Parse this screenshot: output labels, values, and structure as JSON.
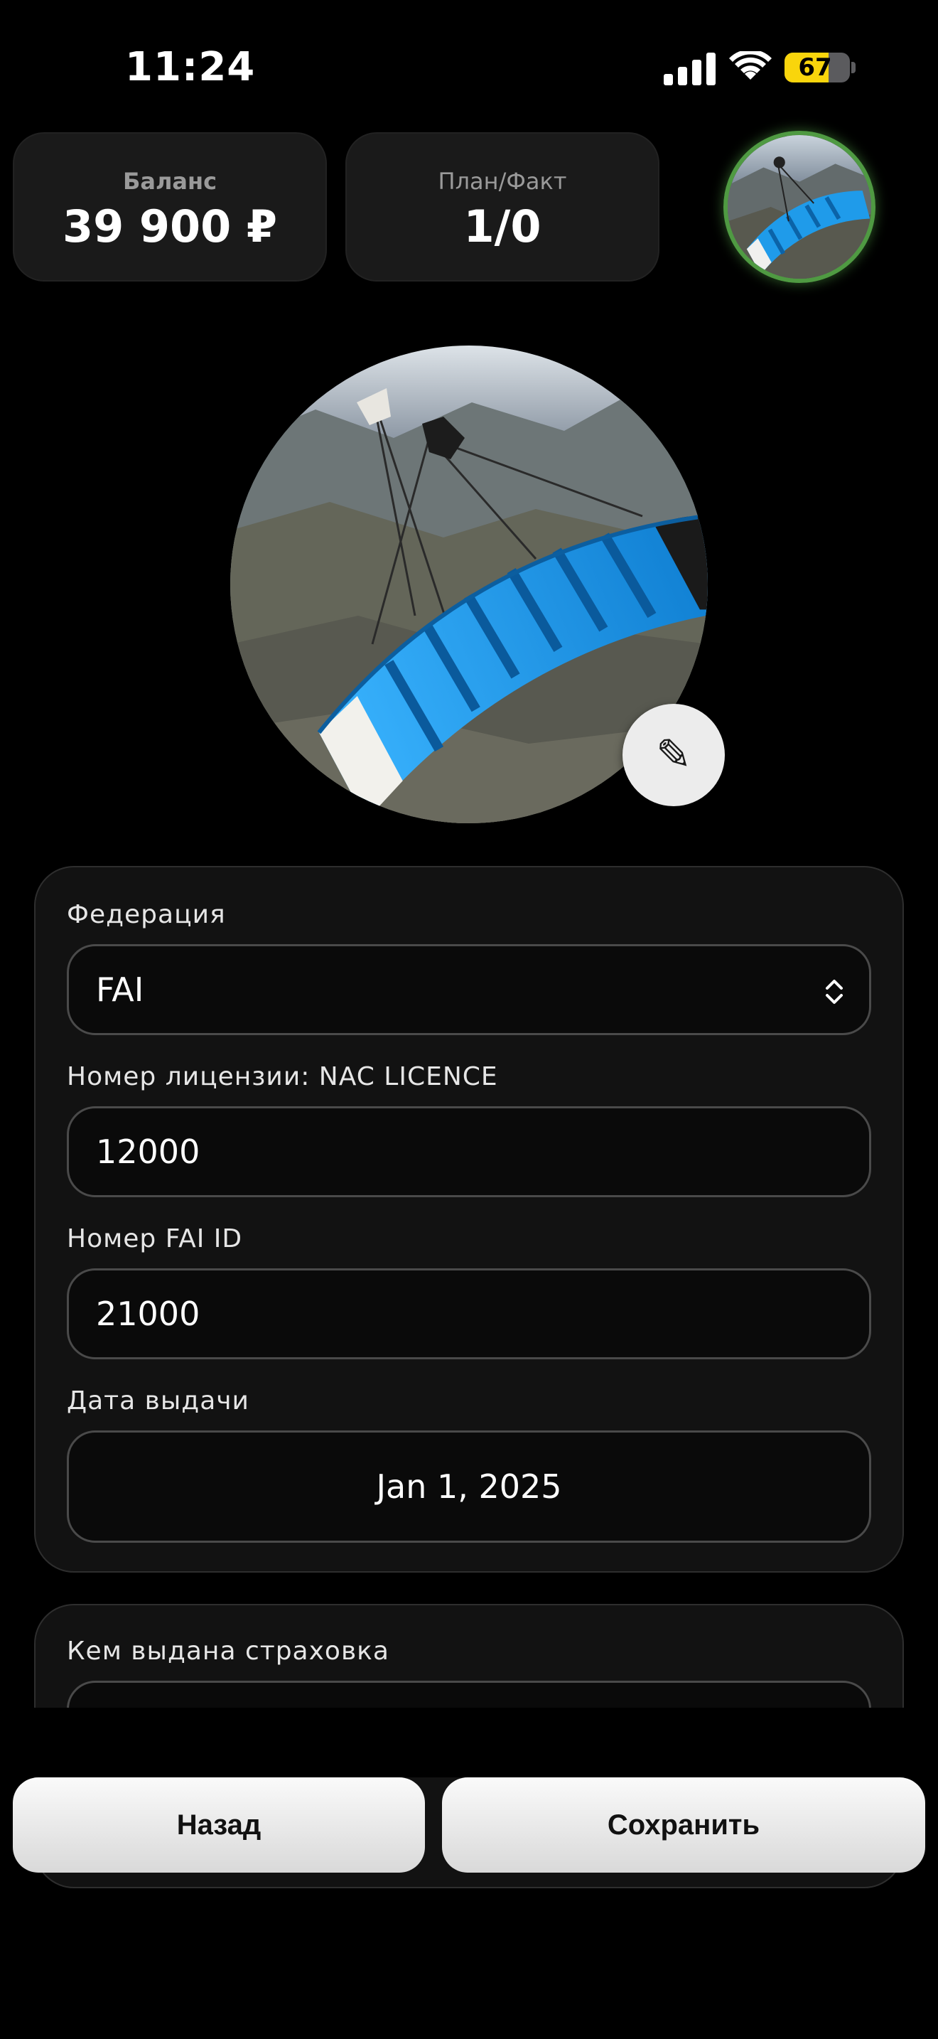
{
  "status_bar": {
    "time": "11:24",
    "battery": "67",
    "battery_level": 0.67
  },
  "header": {
    "balance_label": "Баланс",
    "balance_value": "39 900 ₽",
    "plan_label": "План/Факт",
    "plan_value": "1/0"
  },
  "form": {
    "federation_label": "Федерация",
    "federation_value": "FAI",
    "license_label": "Номер лицензии: NAC LICENCE",
    "license_value": "12000",
    "fai_id_label": "Номер FAI ID",
    "fai_id_value": "21000",
    "issue_date_label": "Дата выдачи",
    "issue_date_value": "Jan 1, 2025"
  },
  "insurance": {
    "issuer_label": "Кем выдана страховка"
  },
  "buttons": {
    "back": "Назад",
    "save": "Сохранить"
  },
  "icons": {
    "edit": "pencil-icon",
    "select": "chevron-up-down-icon"
  },
  "colors": {
    "avatar_ring": "#4f9a42",
    "battery": "#f9d50c"
  }
}
